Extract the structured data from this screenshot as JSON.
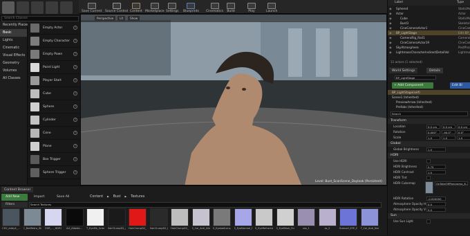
{
  "toolbar": {
    "buttons": [
      {
        "label": "Save Current",
        "icon": "save-icon",
        "color": "#8a8a8a"
      },
      {
        "label": "Source Control",
        "icon": "source-control-icon",
        "color": "#9a9a9a"
      },
      {
        "label": "Content",
        "icon": "content-icon",
        "color": "#a08a60"
      },
      {
        "label": "Marketplace",
        "icon": "marketplace-icon",
        "color": "#8a8a8a"
      },
      {
        "label": "Settings",
        "icon": "gear-icon",
        "color": "#8a8a8a"
      },
      {
        "label": "Blueprints",
        "icon": "blueprint-icon",
        "color": "#5d7fbf"
      },
      {
        "label": "Cinematics",
        "icon": "cinematics-icon",
        "color": "#8a8a8a"
      },
      {
        "label": "Build",
        "icon": "build-icon",
        "color": "#8a8a8a"
      },
      {
        "label": "Play",
        "icon": "play-icon",
        "color": "#8a8a8a"
      },
      {
        "label": "Launch",
        "icon": "launch-icon",
        "color": "#8a8a8a"
      }
    ]
  },
  "modes": {
    "icons": [
      "place-mode-icon",
      "paint-mode-icon",
      "landscape-mode-icon",
      "foliage-mode-icon",
      "geometry-mode-icon"
    ]
  },
  "place": {
    "search_placeholder": "Search Classes",
    "categories": [
      "Recently Placed",
      "Basic",
      "Lights",
      "Cinematic",
      "Visual Effects",
      "Geometry",
      "Volumes",
      "All Classes"
    ],
    "actors": [
      {
        "label": "Empty Actor",
        "color": "#6a6a6a"
      },
      {
        "label": "Empty Character",
        "color": "#7d7d7d"
      },
      {
        "label": "Empty Pawn",
        "color": "#7a7a7a"
      },
      {
        "label": "Point Light",
        "color": "#d8d8d8"
      },
      {
        "label": "Player Start",
        "color": "#9a9a9a"
      },
      {
        "label": "Cube",
        "color": "#bdbdbd"
      },
      {
        "label": "Sphere",
        "color": "#cfcfcf"
      },
      {
        "label": "Cylinder",
        "color": "#c3c3c3"
      },
      {
        "label": "Cone",
        "color": "#b5b5b5"
      },
      {
        "label": "Plane",
        "color": "#d0d0d0"
      },
      {
        "label": "Box Trigger",
        "color": "#5a5a5a"
      },
      {
        "label": "Sphere Trigger",
        "color": "#5f5f5f"
      }
    ]
  },
  "viewport": {
    "buttons": [
      "Perspective",
      "Lit",
      "Show"
    ],
    "footer": "Level: Bust_ScanScene_Daylook (Persistent)"
  },
  "outliner": {
    "headers": [
      "Label",
      "Type"
    ],
    "rows": [
      {
        "label": "Sphere4",
        "type": "StaticMe",
        "sel": false
      },
      {
        "label": "Actor",
        "type": "Actor",
        "sel": false
      },
      {
        "label": "Cube",
        "type": "StaticMe",
        "sel": false
      },
      {
        "label": "Bust3",
        "type": "SkeletalM",
        "sel": false
      },
      {
        "label": "CineCameraActor1",
        "type": "CineCam",
        "sel": false
      },
      {
        "label": "BP_LightStage",
        "type": "Edit BP_",
        "sel": true
      },
      {
        "label": "CameraRig_Rail1",
        "type": "CameraR",
        "sel": false
      },
      {
        "label": "CineCameraActor19",
        "type": "CineCam",
        "sel": false
      },
      {
        "label": "SkyAtmosphere",
        "type": "PostProc",
        "sel": false
      },
      {
        "label": "LightmassCharacterIndirectDetailVol",
        "type": "LightmassCh",
        "sel": false
      }
    ],
    "count": "11 actors (1 selected)"
  },
  "details": {
    "tabs": [
      "World Settings",
      "Details"
    ],
    "name_value": "BP_LightStage",
    "add_component": "+ Add Component",
    "edit_blueprint": "Edit Bl",
    "components": [
      "BP_LightStage(self)",
      "Scene1 (Inherited)",
      "PreviewArrow (Inherited)",
      "Prefabs (Inherited)"
    ],
    "search_placeholder": "Search",
    "sections": [
      {
        "title": "Transform",
        "rows": [
          {
            "label": "Location",
            "values": [
              "0.0 cm",
              "0.0 cm",
              "0.0 cm"
            ]
          },
          {
            "label": "Rotation",
            "values": [
              "0.000°",
              "-90.0°",
              "0.0°"
            ]
          },
          {
            "label": "Scale",
            "values": [
              "1.0",
              "1.0",
              "1.0"
            ]
          }
        ]
      },
      {
        "title": "Global",
        "rows": [
          {
            "label": "Global Brightness",
            "values": [
              "1.0"
            ]
          }
        ]
      },
      {
        "title": "HDRI",
        "rows": [
          {
            "label": "Use HDRI",
            "values": []
          },
          {
            "label": "HDRI Brightness",
            "values": [
              "0.75"
            ]
          },
          {
            "label": "HDRI Contrast",
            "values": [
              "1.0"
            ]
          },
          {
            "label": "HDRI Tint",
            "values": []
          }
        ]
      },
      {
        "title": "",
        "rows": [
          {
            "label": "HDRI Cubemap",
            "values": [
              "OnTakeOffPanorama_6..."
            ]
          },
          {
            "label": "HDRI Rotation",
            "values": [
              "-0.000000"
            ]
          },
          {
            "label": "Atmosphere Opacity H",
            "values": [
              "0.0"
            ]
          },
          {
            "label": "Atmosphere Opacity V",
            "values": [
              "0.0"
            ]
          }
        ]
      },
      {
        "title": "Sun",
        "rows": [
          {
            "label": "Use Sun Light",
            "values": []
          }
        ]
      }
    ]
  },
  "content_browser": {
    "tab": "Content Browser",
    "add_new": "Add New",
    "import": "Import",
    "save_all": "Save All",
    "path": [
      "Content",
      "Bust",
      "Textures"
    ],
    "filters": "Filters",
    "search_placeholder": "Search Textures",
    "assets": [
      {
        "label": "CH2_eddy4_...",
        "color": "#4a5560"
      },
      {
        "label": "C_BallRetro_Stone",
        "color": "#7b8a95"
      },
      {
        "label": "EXR_..._HDRI",
        "color": "#d6d6f0"
      },
      {
        "label": "Art_Albedo...",
        "color": "#0a0a0a"
      },
      {
        "label": "T_EyeMk_Sclera_Displacement",
        "color": "#f0f0f0"
      },
      {
        "label": "HairClumpD2_Alpha",
        "color": "#1a1a1a"
      },
      {
        "label": "HairClumpD2_Cartesian",
        "color": "#e01818"
      },
      {
        "label": "HairClumpD2_Depth",
        "color": "#2a2a2a"
      },
      {
        "label": "HairClumpD2_Scale",
        "color": "#bdbdbd"
      },
      {
        "label": "S_Col_Anti_Albedo",
        "color": "#c7c2cf"
      },
      {
        "label": "S_EyeballLens_Color",
        "color": "#7a7a7a"
      },
      {
        "label": "S_EyeNormal_Normal",
        "color": "#a6a6e8"
      },
      {
        "label": "S_EyeRefraction_Displacement",
        "color": "#c9c9c9"
      },
      {
        "label": "S_EyeMask_Frame",
        "color": "#d0d0d0"
      },
      {
        "label": "sss_1",
        "color": "#9a8fb0"
      },
      {
        "label": "ss_2",
        "color": "#b8b0cc"
      },
      {
        "label": "Subsurf_EYE_Displacement",
        "color": "#6d74d8"
      },
      {
        "label": "T_Col_Anti_Normal",
        "color": "#8d93d8"
      }
    ]
  }
}
